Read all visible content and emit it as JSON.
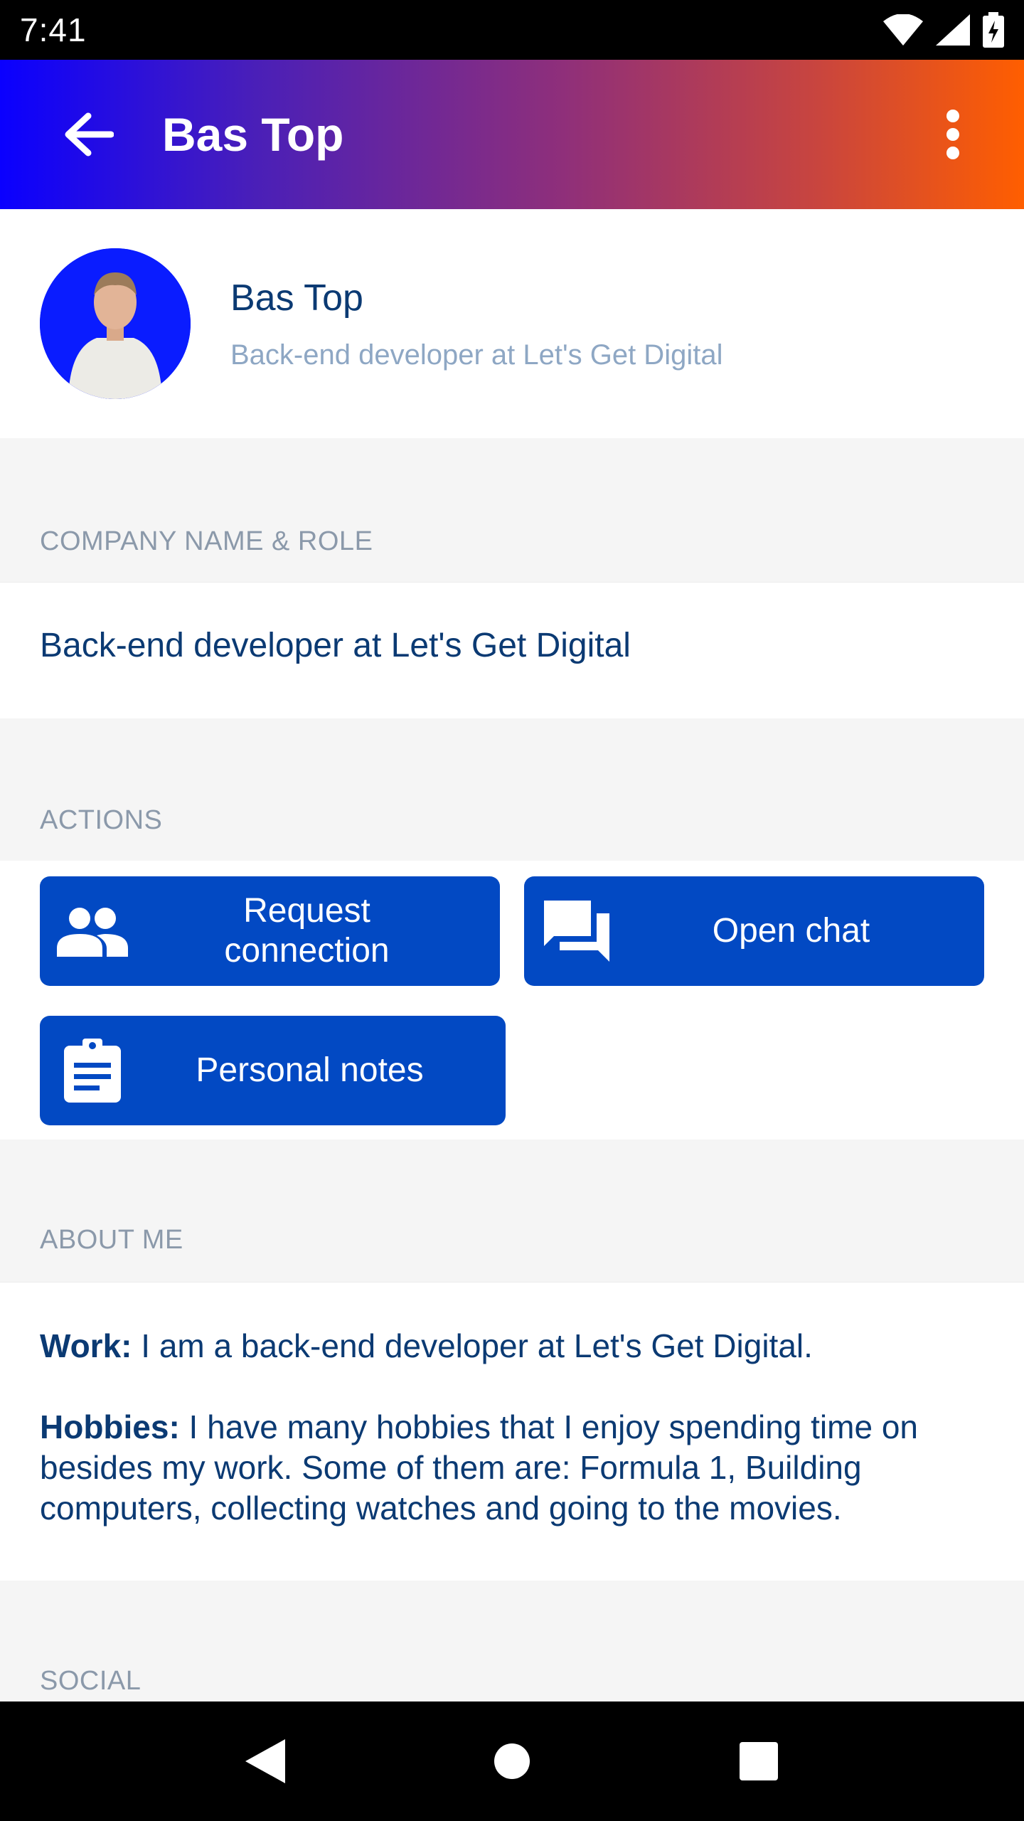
{
  "status_bar": {
    "time": "7:41"
  },
  "app_bar": {
    "title": "Bas Top"
  },
  "profile": {
    "name": "Bas Top",
    "role": "Back-end developer at Let's Get Digital"
  },
  "sections": {
    "company_label": "COMPANY NAME & ROLE",
    "company_value": "Back-end developer at Let's Get Digital",
    "actions_label": "ACTIONS",
    "about_label": "ABOUT ME",
    "social_label": "SOCIAL"
  },
  "actions": {
    "request_connection_line1": "Request",
    "request_connection_line2": "connection",
    "open_chat": "Open chat",
    "personal_notes": "Personal notes"
  },
  "about": {
    "work_label": "Work:",
    "work_text": " I am a back-end developer at Let's Get Digital.",
    "hobbies_label": "Hobbies:",
    "hobbies_text": " I have many hobbies that I enjoy spending time on besides my work. Some of them are: Formula 1, Building computers, collecting watches and going to the movies."
  },
  "icons": {
    "back": "arrow-left-icon",
    "menu": "more-vert-icon",
    "request": "people-icon",
    "chat": "chat-icon",
    "notes": "clipboard-icon"
  },
  "colors": {
    "gradient_start": "#0a00ff",
    "gradient_end": "#ff5e00",
    "button_blue": "#0249c3",
    "text_navy": "#0b3a73"
  }
}
